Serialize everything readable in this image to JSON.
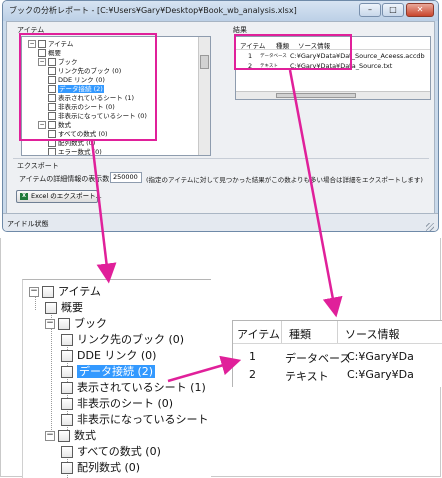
{
  "dialog": {
    "title": "ブックの分析レポート - [C:¥Users¥Gary¥Desktop¥Book_wb_analysis.xlsx]",
    "minimize": "–",
    "maximize": "□",
    "close": "✕"
  },
  "items_label": "アイテム",
  "results_label": "結果",
  "tree": [
    {
      "label": "アイテム",
      "level": 0,
      "expander": "−",
      "selected": false
    },
    {
      "label": "概要",
      "level": 1,
      "expander": "",
      "selected": false
    },
    {
      "label": "ブック",
      "level": 1,
      "expander": "−",
      "selected": false
    },
    {
      "label": "リンク先のブック (0)",
      "level": 2,
      "expander": "",
      "selected": false
    },
    {
      "label": "DDE リンク (0)",
      "level": 2,
      "expander": "",
      "selected": false
    },
    {
      "label": "データ接続 (2)",
      "level": 2,
      "expander": "",
      "selected": true
    },
    {
      "label": "表示されているシート (1)",
      "level": 2,
      "expander": "",
      "selected": false
    },
    {
      "label": "非表示のシート (0)",
      "level": 2,
      "expander": "",
      "selected": false
    },
    {
      "label": "非表示になっているシート (0)",
      "level": 2,
      "expander": "",
      "selected": false
    },
    {
      "label": "数式",
      "level": 1,
      "expander": "−",
      "selected": false
    },
    {
      "label": "すべての数式 (0)",
      "level": 2,
      "expander": "",
      "selected": false
    },
    {
      "label": "配列数式 (0)",
      "level": 2,
      "expander": "",
      "selected": false
    },
    {
      "label": "エラー数式 (0)",
      "level": 2,
      "expander": "",
      "selected": false
    }
  ],
  "results": {
    "columns": [
      "アイテム",
      "種類",
      "ソース情報"
    ],
    "rows": [
      {
        "item": "1",
        "type": "データベース",
        "source": "C:¥Gary¥Data¥Dat_Source_Aceess.accdb"
      },
      {
        "item": "2",
        "type": "テキスト",
        "source": "C:¥Gary¥Data¥Data_Source.txt"
      }
    ]
  },
  "zoom_results_rows": [
    {
      "item": "1",
      "type": "データベース",
      "source": "C:¥Gary¥Da"
    },
    {
      "item": "2",
      "type": "テキスト",
      "source": "C:¥Gary¥Da"
    }
  ],
  "export": {
    "section_label": "エクスポート",
    "size_label": "アイテムの詳細情報の表示数:",
    "size_value": "250000",
    "note": "(指定のアイテムに対して見つかった結果がこの数よりも多い場合は詳細をエクスポートします)",
    "button_label": "Excel のエクスポート...",
    "excel_icon_glyph": "X"
  },
  "status": "アイドル状態",
  "colors": {
    "highlight": "#e0209a",
    "selection": "#3399ff",
    "frame": "#c9d9ea"
  }
}
